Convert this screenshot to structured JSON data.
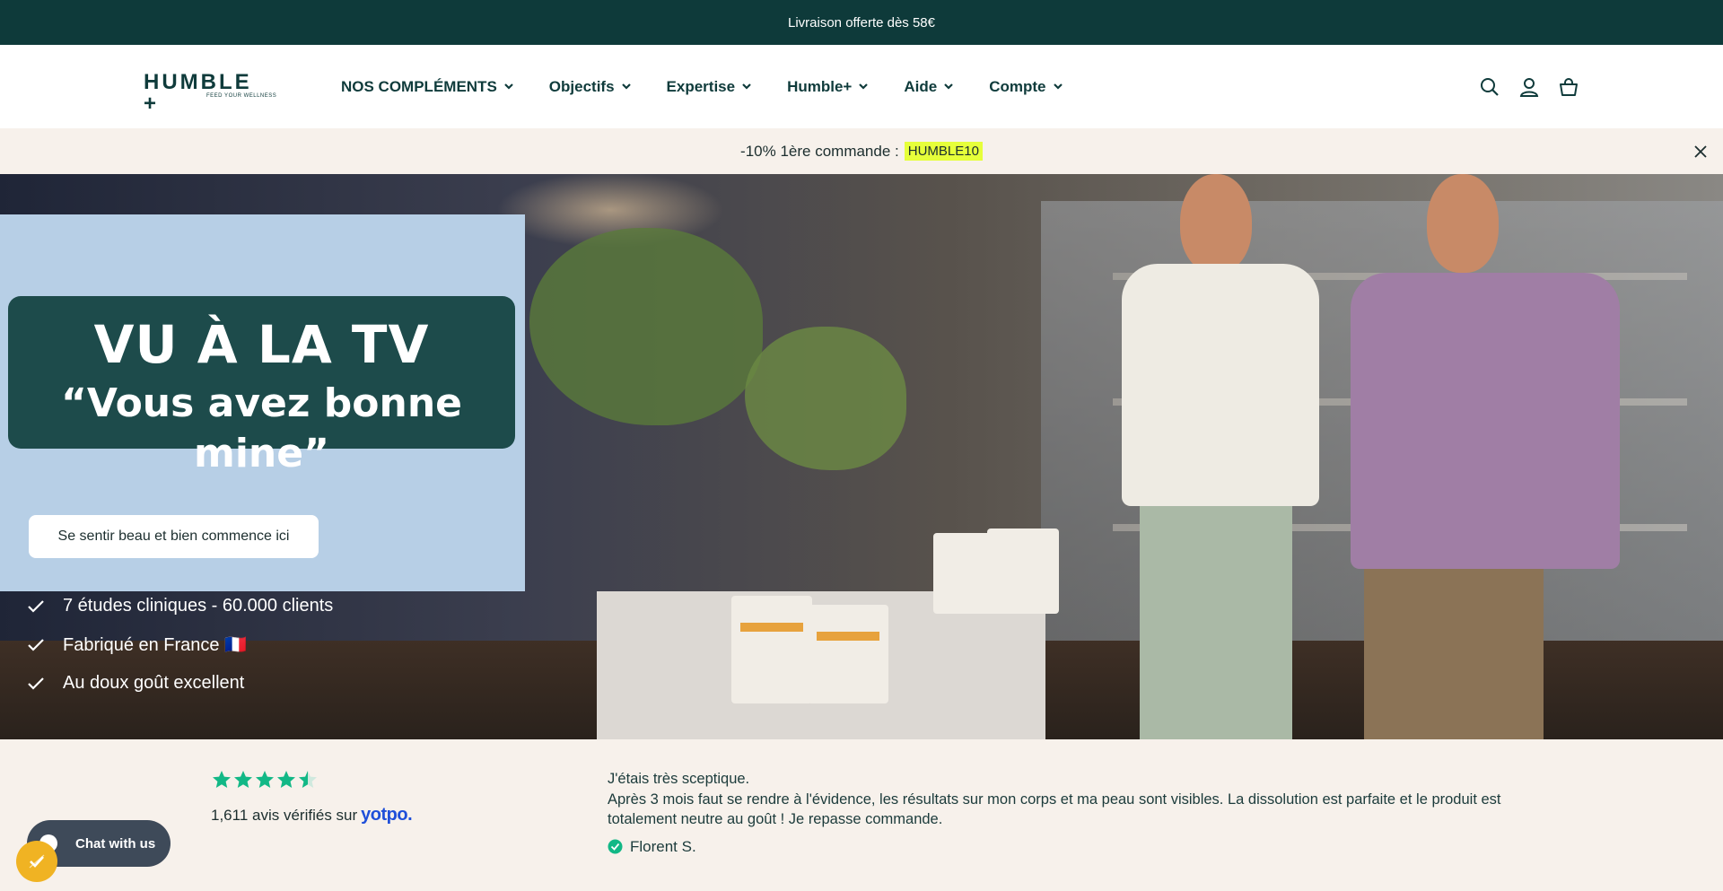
{
  "announcement": {
    "text": "Livraison offerte dès 58€"
  },
  "header": {
    "logo": {
      "name": "HUMBLE +",
      "tagline": "FEED YOUR WELLNESS"
    },
    "nav": [
      {
        "label": "NOS COMPLÉMENTS"
      },
      {
        "label": "Objectifs"
      },
      {
        "label": "Expertise"
      },
      {
        "label": "Humble+"
      },
      {
        "label": "Aide"
      },
      {
        "label": "Compte"
      }
    ],
    "icons": [
      "search-icon",
      "account-icon",
      "cart-icon"
    ]
  },
  "promo": {
    "text": "-10% 1ère commande :",
    "code": "HUMBLE10"
  },
  "hero": {
    "tv_title": "VU À LA TV",
    "tv_quote": "“Vous avez bonne mine”",
    "cta": "Se sentir beau et bien commence ici",
    "bullets": [
      {
        "text": "7 études cliniques - 60.000 clients"
      },
      {
        "text": "Fabriqué en France 🇫🇷"
      },
      {
        "text": "Au doux goût excellent"
      }
    ]
  },
  "reviews": {
    "rating": 4.5,
    "count": "1,611",
    "count_text": "avis vérifiés sur",
    "platform": "yotpo.",
    "testimonial_title": "J'étais très sceptique.",
    "testimonial_body": "Après 3 mois faut se rendre à l'évidence, les résultats sur mon corps et ma peau sont visibles. La dissolution est parfaite et le produit est totalement neutre au goût ! Je repasse commande.",
    "author": "Florent S."
  },
  "chat": {
    "label": "Chat with us"
  },
  "colors": {
    "brand_dark": "#0e3a3a",
    "promo_bg": "#f7f1eb",
    "code_highlight": "#e6ff3a",
    "star_green": "#12b886",
    "yotpo_blue": "#1f4fd9"
  }
}
